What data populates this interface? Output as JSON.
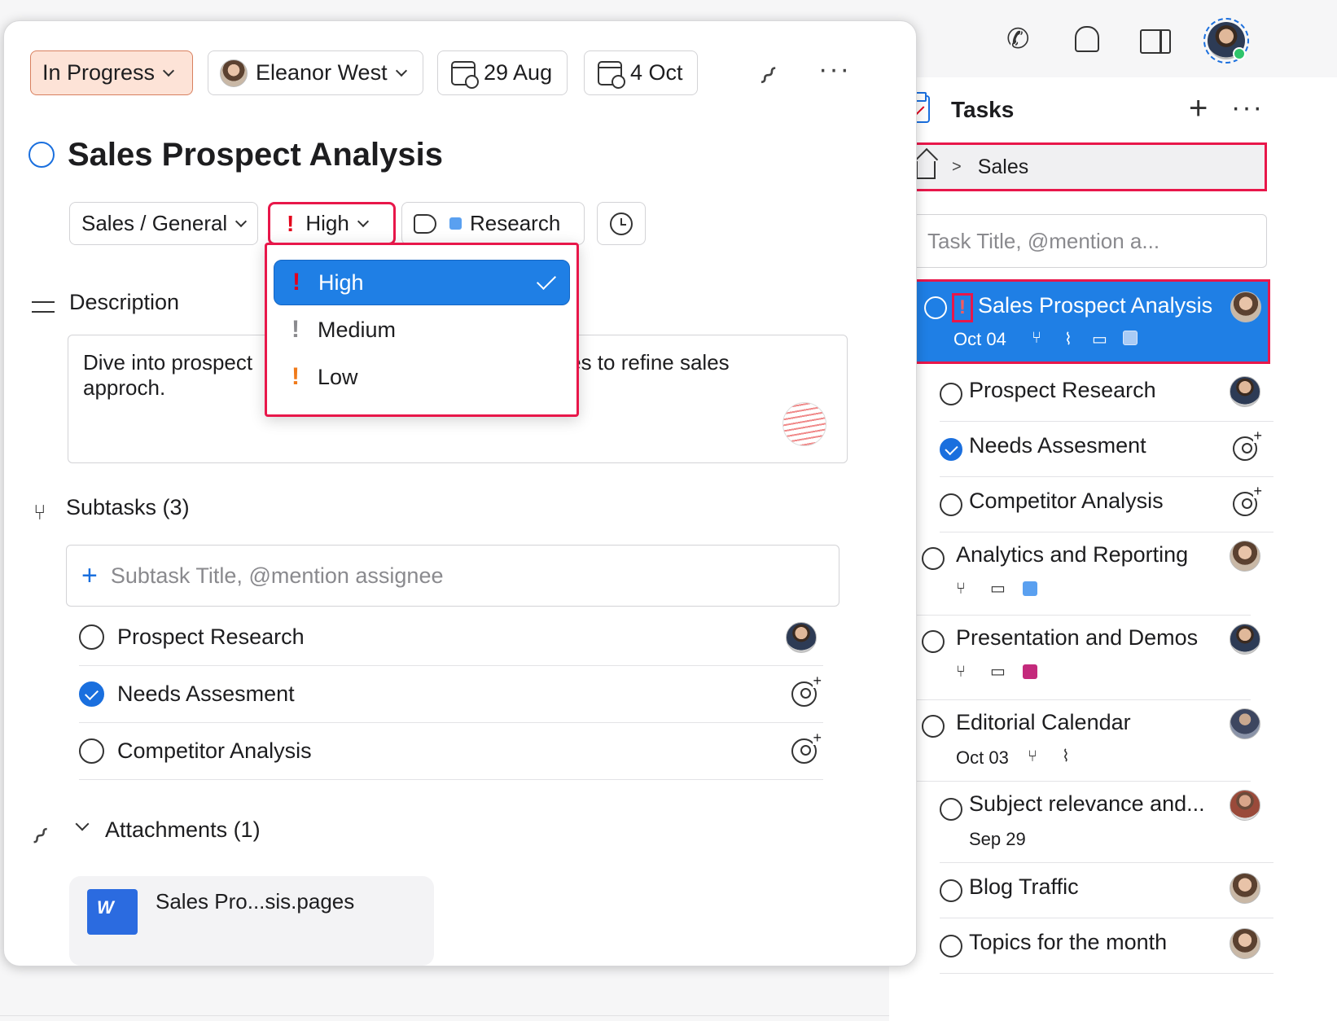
{
  "detail": {
    "status": "In Progress",
    "assignee": "Eleanor West",
    "start_date": "29 Aug",
    "due_date": "4 Oct",
    "title": "Sales Prospect Analysis",
    "project": "Sales / General",
    "priority": "High",
    "tag": "Research",
    "description_label": "Description",
    "description_text": "Dive into prospect",
    "description_text2": "ces to refine sales",
    "description_text3": "approch.",
    "subtasks_label": "Subtasks (3)",
    "subtask_placeholder": "Subtask Title, @mention assignee",
    "subtasks": [
      {
        "title": "Prospect Research",
        "done": false
      },
      {
        "title": "Needs Assesment",
        "done": true
      },
      {
        "title": "Competitor Analysis",
        "done": false
      }
    ],
    "attachments_label": "Attachments (1)",
    "attachment_name": "Sales Pro...sis.pages",
    "attachment_icon_text": "W"
  },
  "priority_menu": [
    {
      "label": "High",
      "color": "#e3001b",
      "selected": true
    },
    {
      "label": "Medium",
      "color": "#8a8a8e",
      "selected": false
    },
    {
      "label": "Low",
      "color": "#f07a1a",
      "selected": false
    }
  ],
  "sidebar": {
    "title": "Tasks",
    "breadcrumb": "Sales",
    "input_placeholder": "Task Title, @mention a...",
    "selected_task": {
      "title": "Sales Prospect Analysis",
      "date": "Oct 04"
    },
    "tasks": [
      {
        "title": "Prospect Research"
      },
      {
        "title": "Needs Assesment"
      },
      {
        "title": "Competitor Analysis"
      },
      {
        "title": "Analytics and Reporting"
      },
      {
        "title": "Presentation and Demos"
      },
      {
        "title": "Editorial Calendar",
        "date": "Oct 03"
      },
      {
        "title": "Subject relevance and...",
        "date": "Sep 29"
      },
      {
        "title": "Blog Traffic"
      },
      {
        "title": "Topics for the month"
      }
    ]
  },
  "colors": {
    "accent": "#1f7fe5",
    "highlight": "#e8174a",
    "status_bg": "#fde3d7"
  }
}
